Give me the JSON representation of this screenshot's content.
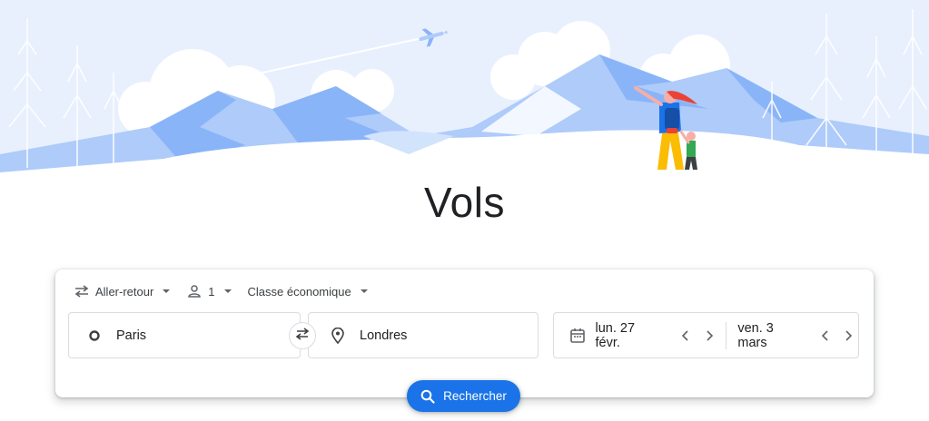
{
  "page": {
    "title": "Vols"
  },
  "colors": {
    "accent": "#1a73e8",
    "illustration_light": "#e8f0fe",
    "illustration_mid": "#aecbfa",
    "illustration_dark": "#8ab4f8"
  },
  "options": {
    "trip_type": {
      "label": "Aller-retour",
      "icon": "round-trip-icon"
    },
    "passengers": {
      "label": "1",
      "icon": "person-icon"
    },
    "cabin_class": {
      "label": "Classe économique"
    }
  },
  "route": {
    "origin": {
      "value": "Paris",
      "icon": "origin-circle-icon"
    },
    "destination": {
      "value": "Londres",
      "icon": "location-pin-icon"
    },
    "swap_icon": "swap-arrows-icon"
  },
  "dates": {
    "departure": "lun. 27 févr.",
    "return": "ven. 3 mars",
    "icon": "calendar-icon"
  },
  "search_button": {
    "label": "Rechercher",
    "icon": "search-icon"
  }
}
